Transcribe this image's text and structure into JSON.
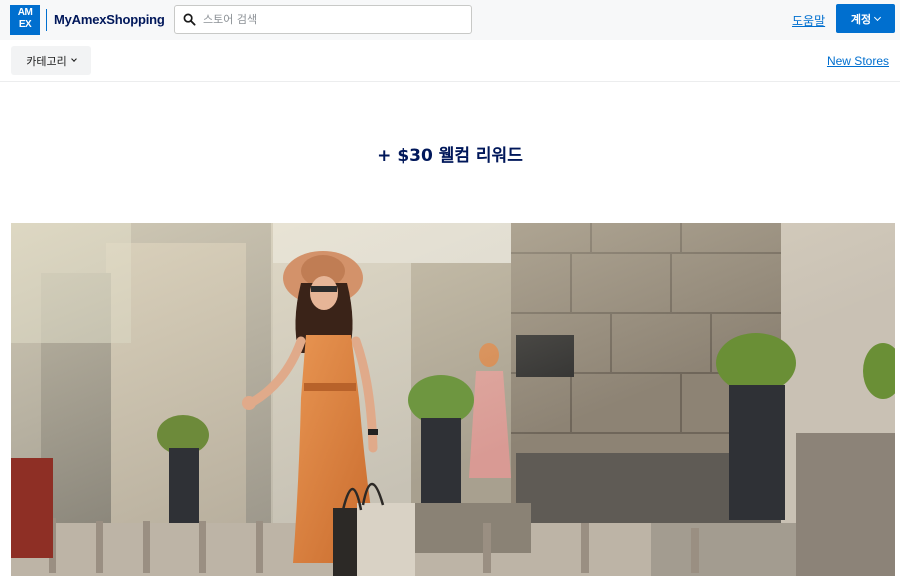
{
  "header": {
    "logo_line1": "AM",
    "logo_line2": "EX",
    "brand": "MyAmexShopping",
    "search": {
      "placeholder": "스토어 검색",
      "value": ""
    },
    "help_label": "도움말",
    "account_label": "계정"
  },
  "subnav": {
    "category_label": "카테고리",
    "new_stores_label": "New Stores"
  },
  "promo": {
    "headline": "+ $30 웰컴 리워드"
  },
  "colors": {
    "brand_blue": "#006fcf",
    "navy": "#00175a",
    "header_bg": "#f7f8f9"
  },
  "icons": [
    "search-icon",
    "chevron-down-icon"
  ]
}
